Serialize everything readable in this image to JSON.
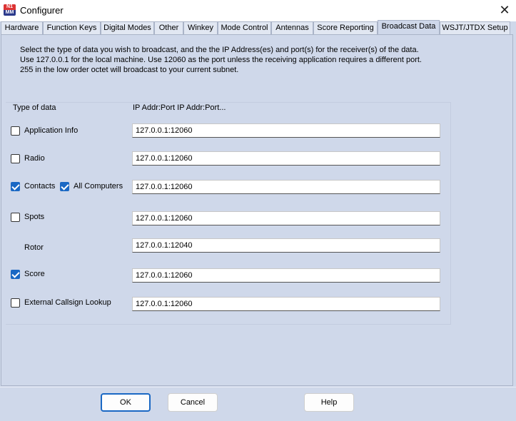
{
  "window": {
    "title": "Configurer",
    "icon_text_top": "N1",
    "icon_text_bottom": "MM",
    "close_glyph": "✕"
  },
  "tabs": [
    {
      "label": "Hardware",
      "active": false
    },
    {
      "label": "Function Keys",
      "active": false
    },
    {
      "label": "Digital Modes",
      "active": false
    },
    {
      "label": "Other",
      "active": false
    },
    {
      "label": "Winkey",
      "active": false
    },
    {
      "label": "Mode Control",
      "active": false
    },
    {
      "label": "Antennas",
      "active": false
    },
    {
      "label": "Score Reporting",
      "active": false
    },
    {
      "label": "Broadcast Data",
      "active": true
    },
    {
      "label": "WSJT/JTDX Setup",
      "active": false
    }
  ],
  "description": [
    "Select the type of data you wish to broadcast, and the the IP Address(es) and port(s) for the receiver(s) of the data.",
    "Use 127.0.0.1 for the local machine.  Use 12060 as the port unless the receiving application requires a different port.",
    "255 in the low order octet will broadcast to your current subnet."
  ],
  "headers": {
    "type_of_data": "Type of data",
    "ip_addr_port": "IP Addr:Port IP Addr:Port..."
  },
  "rows": [
    {
      "label": "Application Info",
      "has_checkbox": true,
      "checked": false,
      "value": "127.0.0.1:12060"
    },
    {
      "label": "Radio",
      "has_checkbox": true,
      "checked": false,
      "value": "127.0.0.1:12060"
    },
    {
      "label": "Contacts",
      "has_checkbox": true,
      "checked": true,
      "value": "127.0.0.1:12060",
      "extra_label": "All Computers",
      "extra_checked": true
    },
    {
      "label": "Spots",
      "has_checkbox": true,
      "checked": false,
      "value": "127.0.0.1:12060"
    },
    {
      "label": "Rotor",
      "has_checkbox": false,
      "checked": false,
      "value": "127.0.0.1:12040"
    },
    {
      "label": "Score",
      "has_checkbox": true,
      "checked": true,
      "value": "127.0.0.1:12060"
    },
    {
      "label": "External Callsign Lookup",
      "has_checkbox": true,
      "checked": false,
      "value": "127.0.0.1:12060"
    }
  ],
  "buttons": {
    "ok": "OK",
    "cancel": "Cancel",
    "help": "Help"
  },
  "colors": {
    "accent": "#1a68c4",
    "panel_bg": "#cfd8ea"
  },
  "icons": {
    "app": "app-logo-icon",
    "close": "close-icon",
    "check": "checkmark-icon"
  }
}
